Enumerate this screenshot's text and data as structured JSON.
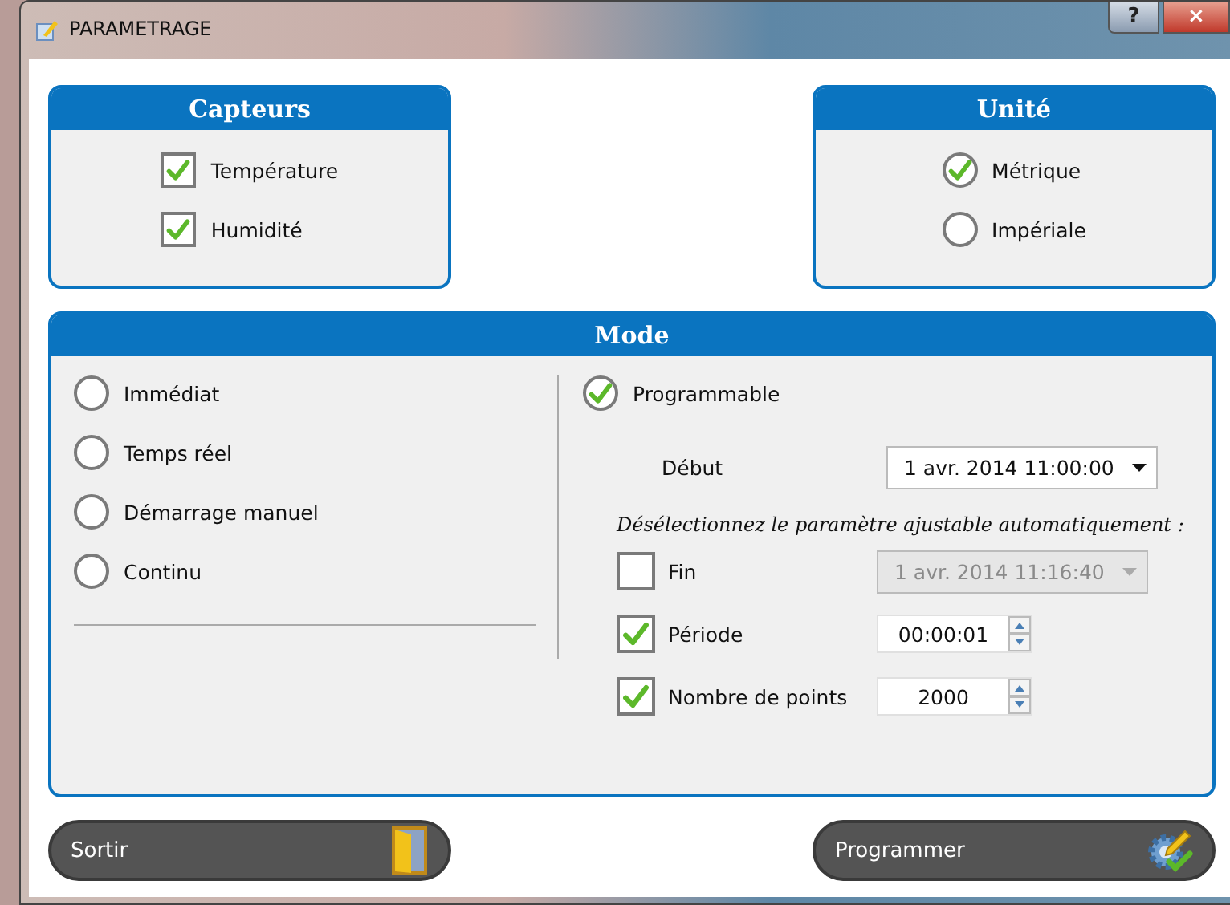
{
  "window": {
    "title": "PARAMETRAGE",
    "help_button": "?",
    "close_button": "×"
  },
  "sensors": {
    "title": "Capteurs",
    "items": [
      {
        "label": "Température",
        "checked": true
      },
      {
        "label": "Humidité",
        "checked": true
      }
    ]
  },
  "unit": {
    "title": "Unité",
    "options": [
      {
        "label": "Métrique",
        "selected": true
      },
      {
        "label": "Impériale",
        "selected": false
      }
    ]
  },
  "mode": {
    "title": "Mode",
    "options": [
      {
        "label": "Immédiat",
        "selected": false
      },
      {
        "label": "Temps réel",
        "selected": false
      },
      {
        "label": "Démarrage manuel",
        "selected": false
      },
      {
        "label": "Continu",
        "selected": false
      }
    ],
    "programmable": {
      "label": "Programmable",
      "selected": true
    },
    "start": {
      "label": "Début",
      "value": "1 avr. 2014 11:00:00"
    },
    "hint": "Désélectionnez le paramètre ajustable automatiquement :",
    "params": [
      {
        "kind": "combo",
        "label": "Fin",
        "checked": false,
        "value": "1 avr. 2014 11:16:40",
        "disabled": true
      },
      {
        "kind": "spin",
        "label": "Période",
        "checked": true,
        "value": "00:00:01",
        "disabled": false
      },
      {
        "kind": "spin",
        "label": "Nombre de points",
        "checked": true,
        "value": "2000",
        "disabled": false
      }
    ]
  },
  "actions": [
    {
      "kind": "exit",
      "label": "Sortir"
    },
    {
      "kind": "program",
      "label": "Programmer"
    }
  ]
}
